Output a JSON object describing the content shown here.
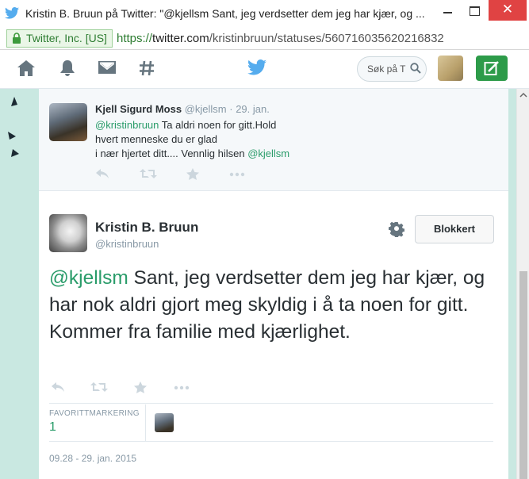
{
  "window": {
    "title": "Kristin B. Bruun på Twitter: \"@kjellsm Sant, jeg verdsetter dem jeg har kjær, og ...",
    "close_glyph": "✕"
  },
  "address": {
    "cert_label": "Twitter, Inc. [US]",
    "scheme": "https://",
    "host": "twitter.com",
    "path": "/kristinbruun/statuses/560716035620216832"
  },
  "nav": {
    "icons": [
      "home-icon",
      "notifications-icon",
      "messages-icon",
      "discover-icon",
      "twitter-bird-icon"
    ],
    "search_placeholder": "Søk på T"
  },
  "reply": {
    "name": "Kjell Sigurd Moss",
    "handle": "@kjellsm",
    "separator": " · ",
    "date": "29. jan.",
    "mention": "@kristinbruun",
    "line1": " Ta aldri noen for gitt.Hold",
    "line2": "hvert menneske du er glad",
    "line3": "i nær hjertet ditt.... Vennlig hilsen ",
    "signoff_mention": "@kjellsm"
  },
  "tweet": {
    "name": "Kristin B. Bruun",
    "handle": "@kristinbruun",
    "block_label": "Blokkert",
    "mention": "@kjellsm",
    "text": " Sant, jeg verdsetter dem jeg har kjær, og har nok aldri gjort meg skyldig i å ta noen for gitt. Kommer fra familie med kjærlighet.",
    "favorites_label": "FAVORITTMARKERING",
    "favorites_count": "1",
    "timestamp": "09.28 - 29. jan. 2015"
  },
  "colors": {
    "accent": "#2a9c6a",
    "bird": "#55acee",
    "background": "#c9e8e1",
    "close": "#e04343"
  }
}
